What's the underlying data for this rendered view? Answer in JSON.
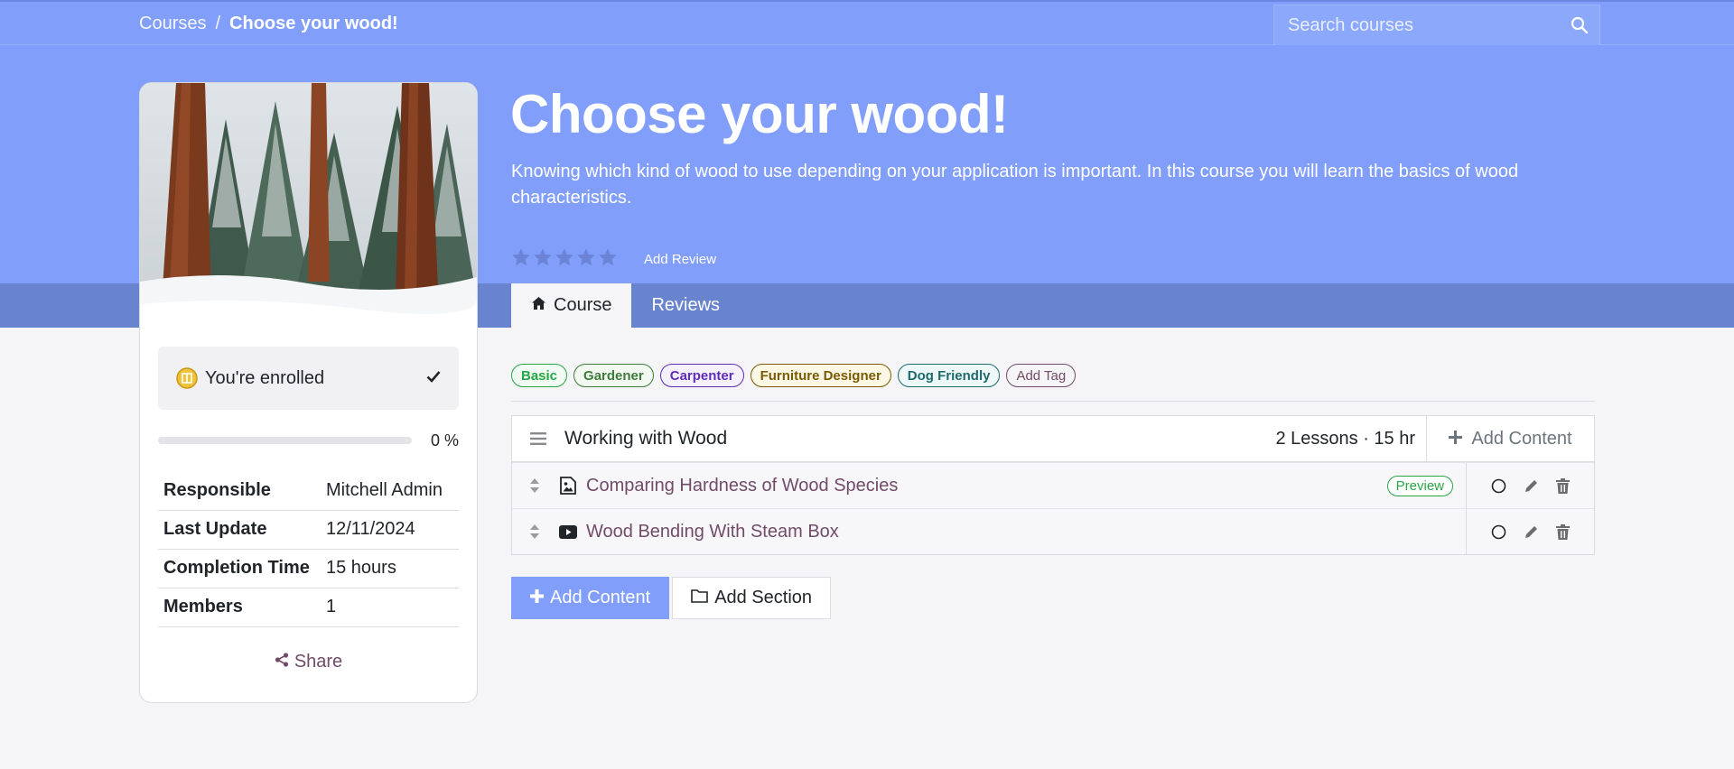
{
  "breadcrumb": {
    "courses": "Courses",
    "separator": "/",
    "current": "Choose your wood!"
  },
  "search": {
    "placeholder": "Search courses",
    "icon": "search-icon"
  },
  "hero": {
    "title": "Choose your wood!",
    "subtitle": "Knowing which kind of wood to use depending on your application is important. In this course you will learn the basics of wood characteristics.",
    "rating_stars": 0,
    "rating_max": 5,
    "add_review": "Add Review"
  },
  "tabs": [
    {
      "label": "Course",
      "icon": "home-icon",
      "active": true
    },
    {
      "label": "Reviews",
      "active": false
    }
  ],
  "sidebar": {
    "enrolled_text": "You're enrolled",
    "progress_value": 0,
    "progress_label": "0 %",
    "info": [
      {
        "key": "Responsible",
        "value": "Mitchell Admin"
      },
      {
        "key": "Last Update",
        "value": "12/11/2024"
      },
      {
        "key": "Completion Time",
        "value": "15 hours"
      },
      {
        "key": "Members",
        "value": "1"
      }
    ],
    "share": "Share"
  },
  "tags": [
    {
      "label": "Basic",
      "color": "#28a745",
      "bg": "#f1faf3"
    },
    {
      "label": "Gardener",
      "color": "#3d7b3d",
      "bg": "#f3f9f0"
    },
    {
      "label": "Carpenter",
      "color": "#5e2fb5",
      "bg": "#f5f0fd"
    },
    {
      "label": "Furniture Designer",
      "color": "#7a5a00",
      "bg": "#fdf8e6"
    },
    {
      "label": "Dog Friendly",
      "color": "#1e6b6b",
      "bg": "#eef8f8"
    },
    {
      "label": "Add Tag",
      "color": "#714b67",
      "bg": "#f5f5f7"
    }
  ],
  "section": {
    "name": "Working with Wood",
    "meta": "2 Lessons · 15 hr",
    "add_content": "Add Content",
    "lessons": [
      {
        "name": "Comparing Hardness of Wood Species",
        "type_icon": "image-icon",
        "preview": "Preview"
      },
      {
        "name": "Wood Bending With Steam Box",
        "type_icon": "video-icon",
        "preview": ""
      }
    ]
  },
  "buttons": {
    "add_content": "Add Content",
    "add_section": "Add Section"
  },
  "colors": {
    "primary": "#819ffa",
    "band": "#6984cf",
    "link": "#714b67"
  }
}
